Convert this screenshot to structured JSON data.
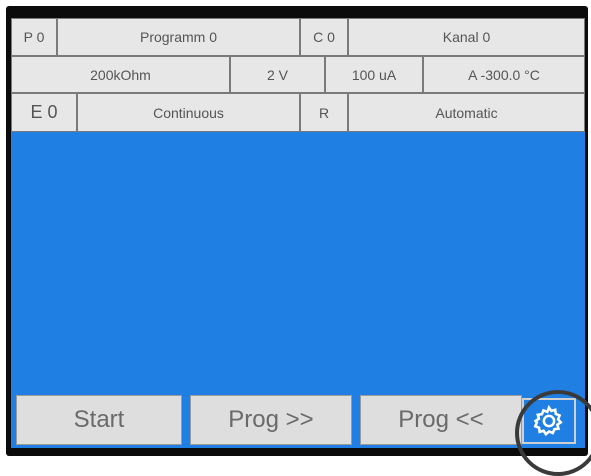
{
  "row1": {
    "program_id": "P 0",
    "program_name": "Programm 0",
    "channel_id": "C 0",
    "channel_name": "Kanal 0"
  },
  "row2": {
    "range": "200kOhm",
    "voltage": "2 V",
    "current": "100 uA",
    "temperature": "A -300.0 °C"
  },
  "row3": {
    "mode_id": "E 0",
    "mode": "Continuous",
    "range_flag": "R",
    "range_mode": "Automatic"
  },
  "buttons": {
    "start": "Start",
    "prog_next": "Prog >>",
    "prog_prev": "Prog <<"
  },
  "icons": {
    "settings": "gear-icon"
  },
  "colors": {
    "screen_background": "#1f7fe3",
    "cell_background": "#e7e7e7",
    "highlight_circle": "#3a3a3a"
  }
}
